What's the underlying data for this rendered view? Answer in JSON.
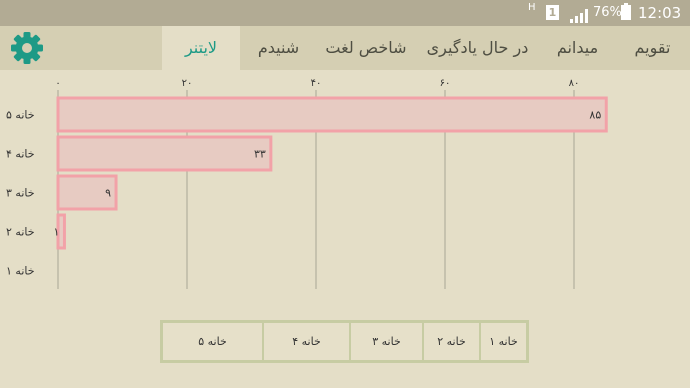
{
  "status_bar": {
    "network_type": "H",
    "sim_slot": "1",
    "battery_percent": "76%",
    "time": "12:03"
  },
  "toolbar": {
    "settings_icon": "gear-icon",
    "tabs": [
      {
        "label": "تقویم",
        "active": false
      },
      {
        "label": "میدانم",
        "active": false
      },
      {
        "label": "در حال یادگیری",
        "active": false
      },
      {
        "label": "شاخص لغت",
        "active": false
      },
      {
        "label": "شنیدم",
        "active": false
      },
      {
        "label": "لایتنر",
        "active": true
      }
    ]
  },
  "colors": {
    "accent": "#1d9a86",
    "bar_fill": "#e7cbc2",
    "bar_stroke": "#f2a2a8",
    "background": "#e4dec7"
  },
  "chart_data": {
    "type": "bar",
    "orientation": "horizontal",
    "categories": [
      "خانه ۵",
      "خانه ۴",
      "خانه ۳",
      "خانه ۲",
      "خانه ۱"
    ],
    "values": [
      85,
      33,
      9,
      1,
      0
    ],
    "value_labels": [
      "۸۵",
      "۳۳",
      "۹",
      "۱",
      ""
    ],
    "xlim": [
      0,
      85
    ],
    "xticks": [
      0,
      20,
      40,
      60,
      80
    ],
    "xtick_labels": [
      "۰",
      "۲۰",
      "۴۰",
      "۶۰",
      "۸۰"
    ],
    "grid": true,
    "legend": [
      "خانه ۱",
      "خانه ۲",
      "خانه ۳",
      "خانه ۴",
      "خانه ۵"
    ]
  }
}
